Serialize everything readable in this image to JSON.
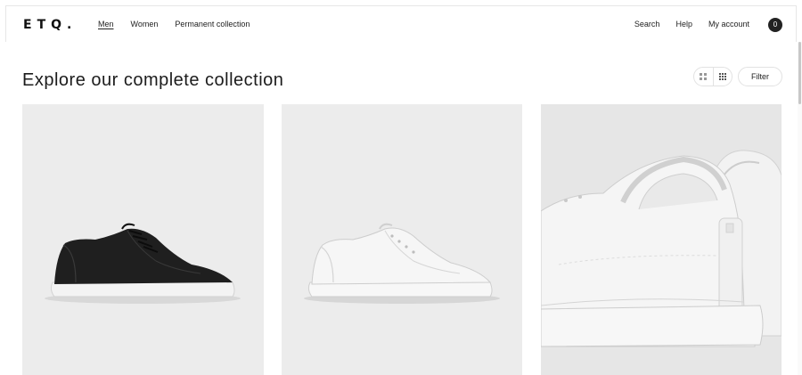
{
  "brand": {
    "logo": "ETQ."
  },
  "nav": {
    "left": [
      "Men",
      "Women",
      "Permanent collection"
    ],
    "active": "Men",
    "right": [
      "Search",
      "Help",
      "My account"
    ],
    "cart_count": "0"
  },
  "page": {
    "title": "Explore our complete collection"
  },
  "toolbar": {
    "filter_label": "Filter",
    "view_modes": [
      "large-grid-icon",
      "small-grid-icon"
    ]
  },
  "products": [
    {
      "image": "black-sneaker-side-view",
      "color": "#1f1f1f"
    },
    {
      "image": "white-sneaker-side-view",
      "color": "#f4f4f4"
    },
    {
      "image": "white-sneakers-heel-closeup",
      "color": "#f2f2f2"
    }
  ],
  "colors": {
    "card_bg": "#ececec",
    "text": "#1a1a1a",
    "accent": "#222222"
  }
}
